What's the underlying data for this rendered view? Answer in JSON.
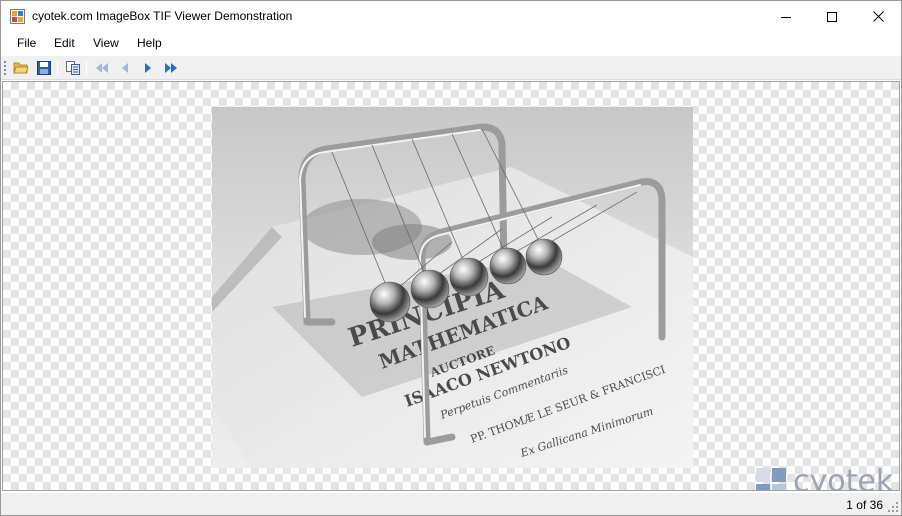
{
  "window": {
    "title": "cyotek.com ImageBox TIF Viewer Demonstration"
  },
  "menu": {
    "items": [
      {
        "label": "File"
      },
      {
        "label": "Edit"
      },
      {
        "label": "View"
      },
      {
        "label": "Help"
      }
    ]
  },
  "toolbar": {
    "buttons": [
      {
        "icon": "open-folder-icon"
      },
      {
        "icon": "save-disk-icon"
      },
      {
        "icon": "copy-icon"
      },
      {
        "icon": "first-page-icon",
        "enabled": false
      },
      {
        "icon": "previous-page-icon",
        "enabled": false
      },
      {
        "icon": "next-page-icon",
        "enabled": true
      },
      {
        "icon": "last-page-icon",
        "enabled": true
      }
    ]
  },
  "image": {
    "subject": "newtons-cradle-on-principia-book",
    "book_text": [
      "PRINCIPIA",
      "MATHEMATICA",
      "AUCTORE",
      "ISAACO NEWTONO",
      "Perpetuis Commentariis",
      "PP. THOMÆ LE SEUR & FRANCISCI",
      "Ex Gallicana Minimorum"
    ]
  },
  "watermark": {
    "text": "cyotek"
  },
  "status": {
    "page_indicator": "1 of 36"
  },
  "colors": {
    "accent_blue": "#1e6fd9",
    "disabled_blue": "#9db8dc",
    "checker": "#e4e4e4",
    "chrome": "#f0f0f0",
    "logo_blue": "#7f9bc0"
  }
}
